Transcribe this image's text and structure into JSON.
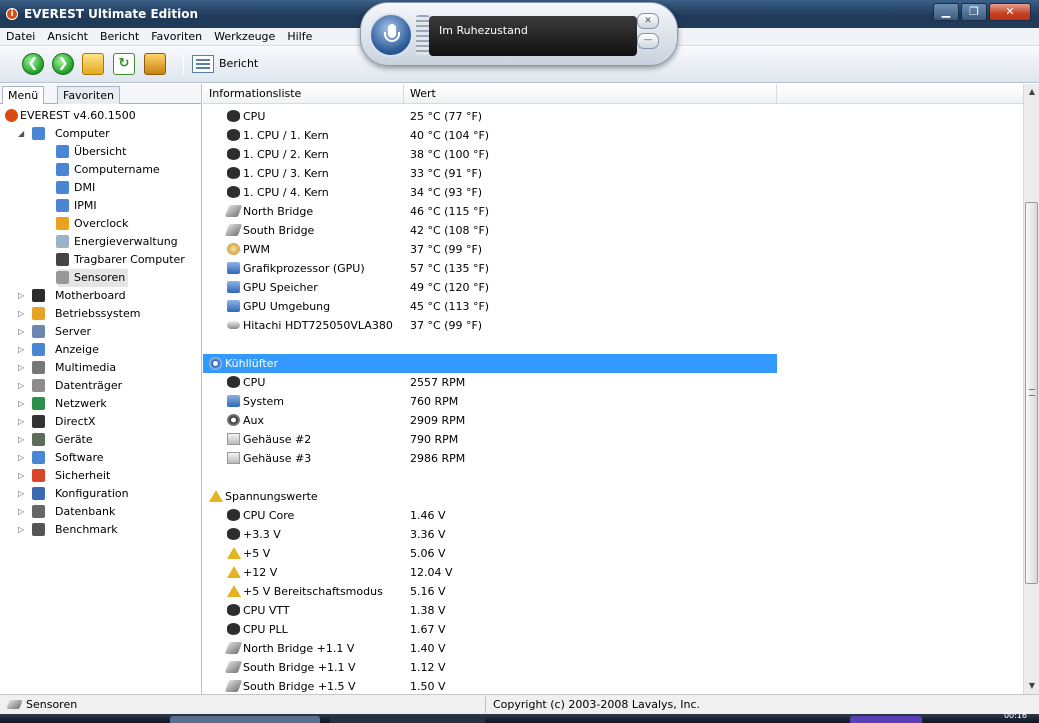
{
  "window": {
    "title": "EVEREST Ultimate Edition"
  },
  "menubar": {
    "items": [
      "Datei",
      "Ansicht",
      "Bericht",
      "Favoriten",
      "Werkzeuge",
      "Hilfe"
    ]
  },
  "toolbar": {
    "report_label": "Bericht"
  },
  "speech": {
    "status": "Im Ruhezustand"
  },
  "left": {
    "tabs": [
      "Menü",
      "Favoriten"
    ],
    "tree": [
      {
        "label": "EVEREST v4.60.1500",
        "icon": "info-icon"
      },
      {
        "label": "Computer",
        "icon": "computer-icon"
      },
      {
        "label": "Übersicht",
        "icon": "computer-icon"
      },
      {
        "label": "Computername",
        "icon": "computer-icon"
      },
      {
        "label": "DMI",
        "icon": "computer-icon"
      },
      {
        "label": "IPMI",
        "icon": "computer-icon"
      },
      {
        "label": "Overclock",
        "icon": "flame-icon"
      },
      {
        "label": "Energieverwaltung",
        "icon": "power-icon"
      },
      {
        "label": "Tragbarer Computer",
        "icon": "laptop-icon"
      },
      {
        "label": "Sensoren",
        "icon": "sensor-icon"
      },
      {
        "label": "Motherboard",
        "icon": "motherboard-icon"
      },
      {
        "label": "Betriebssystem",
        "icon": "os-icon"
      },
      {
        "label": "Server",
        "icon": "server-icon"
      },
      {
        "label": "Anzeige",
        "icon": "display-icon"
      },
      {
        "label": "Multimedia",
        "icon": "multimedia-icon"
      },
      {
        "label": "Datenträger",
        "icon": "storage-icon"
      },
      {
        "label": "Netzwerk",
        "icon": "network-icon"
      },
      {
        "label": "DirectX",
        "icon": "directx-icon"
      },
      {
        "label": "Geräte",
        "icon": "devices-icon"
      },
      {
        "label": "Software",
        "icon": "software-icon"
      },
      {
        "label": "Sicherheit",
        "icon": "security-icon"
      },
      {
        "label": "Konfiguration",
        "icon": "config-icon"
      },
      {
        "label": "Datenbank",
        "icon": "database-icon"
      },
      {
        "label": "Benchmark",
        "icon": "hourglass-icon"
      }
    ]
  },
  "table": {
    "headers": [
      "Informationsliste",
      "Wert"
    ],
    "temps": [
      {
        "name": "CPU",
        "value": "25 °C  (77 °F)",
        "icon": "chip"
      },
      {
        "name": "1. CPU / 1. Kern",
        "value": "40 °C  (104 °F)",
        "icon": "chip"
      },
      {
        "name": "1. CPU / 2. Kern",
        "value": "38 °C  (100 °F)",
        "icon": "chip"
      },
      {
        "name": "1. CPU / 3. Kern",
        "value": "33 °C  (91 °F)",
        "icon": "chip"
      },
      {
        "name": "1. CPU / 4. Kern",
        "value": "34 °C  (93 °F)",
        "icon": "chip"
      },
      {
        "name": "North Bridge",
        "value": "46 °C  (115 °F)",
        "icon": "bridge"
      },
      {
        "name": "South Bridge",
        "value": "42 °C  (108 °F)",
        "icon": "bridge"
      },
      {
        "name": "PWM",
        "value": "37 °C  (99 °F)",
        "icon": "pwm"
      },
      {
        "name": "Grafikprozessor (GPU)",
        "value": "57 °C  (135 °F)",
        "icon": "gpu"
      },
      {
        "name": "GPU Speicher",
        "value": "49 °C  (120 °F)",
        "icon": "gpu"
      },
      {
        "name": "GPU Umgebung",
        "value": "45 °C  (113 °F)",
        "icon": "gpu"
      },
      {
        "name": "Hitachi HDT725050VLA380",
        "value": "37 °C  (99 °F)",
        "icon": "hdd"
      }
    ],
    "fans_group": "Kühllüfter",
    "fans": [
      {
        "name": "CPU",
        "value": "2557 RPM",
        "icon": "chip"
      },
      {
        "name": "System",
        "value": "760 RPM",
        "icon": "gpu"
      },
      {
        "name": "Aux",
        "value": "2909 RPM",
        "icon": "fan"
      },
      {
        "name": "Gehäuse #2",
        "value": "790 RPM",
        "icon": "case"
      },
      {
        "name": "Gehäuse #3",
        "value": "2986 RPM",
        "icon": "case"
      }
    ],
    "volt_group": "Spannungswerte",
    "volts": [
      {
        "name": "CPU Core",
        "value": "1.46 V",
        "icon": "chip"
      },
      {
        "name": "+3.3 V",
        "value": "3.36 V",
        "icon": "chip"
      },
      {
        "name": "+5 V",
        "value": "5.06 V",
        "icon": "warn"
      },
      {
        "name": "+12 V",
        "value": "12.04 V",
        "icon": "warn"
      },
      {
        "name": "+5 V Bereitschaftsmodus",
        "value": "5.16 V",
        "icon": "warn"
      },
      {
        "name": "CPU VTT",
        "value": "1.38 V",
        "icon": "chip"
      },
      {
        "name": "CPU PLL",
        "value": "1.67 V",
        "icon": "chip"
      },
      {
        "name": "North Bridge +1.1 V",
        "value": "1.40 V",
        "icon": "bridge"
      },
      {
        "name": "South Bridge +1.1 V",
        "value": "1.12 V",
        "icon": "bridge"
      },
      {
        "name": "South Bridge +1.5 V",
        "value": "1.50 V",
        "icon": "bridge"
      }
    ]
  },
  "statusbar": {
    "left": "Sensoren",
    "copyright": "Copyright (c) 2003-2008 Lavalys, Inc."
  },
  "taskbar": {
    "clock": "00:16"
  }
}
